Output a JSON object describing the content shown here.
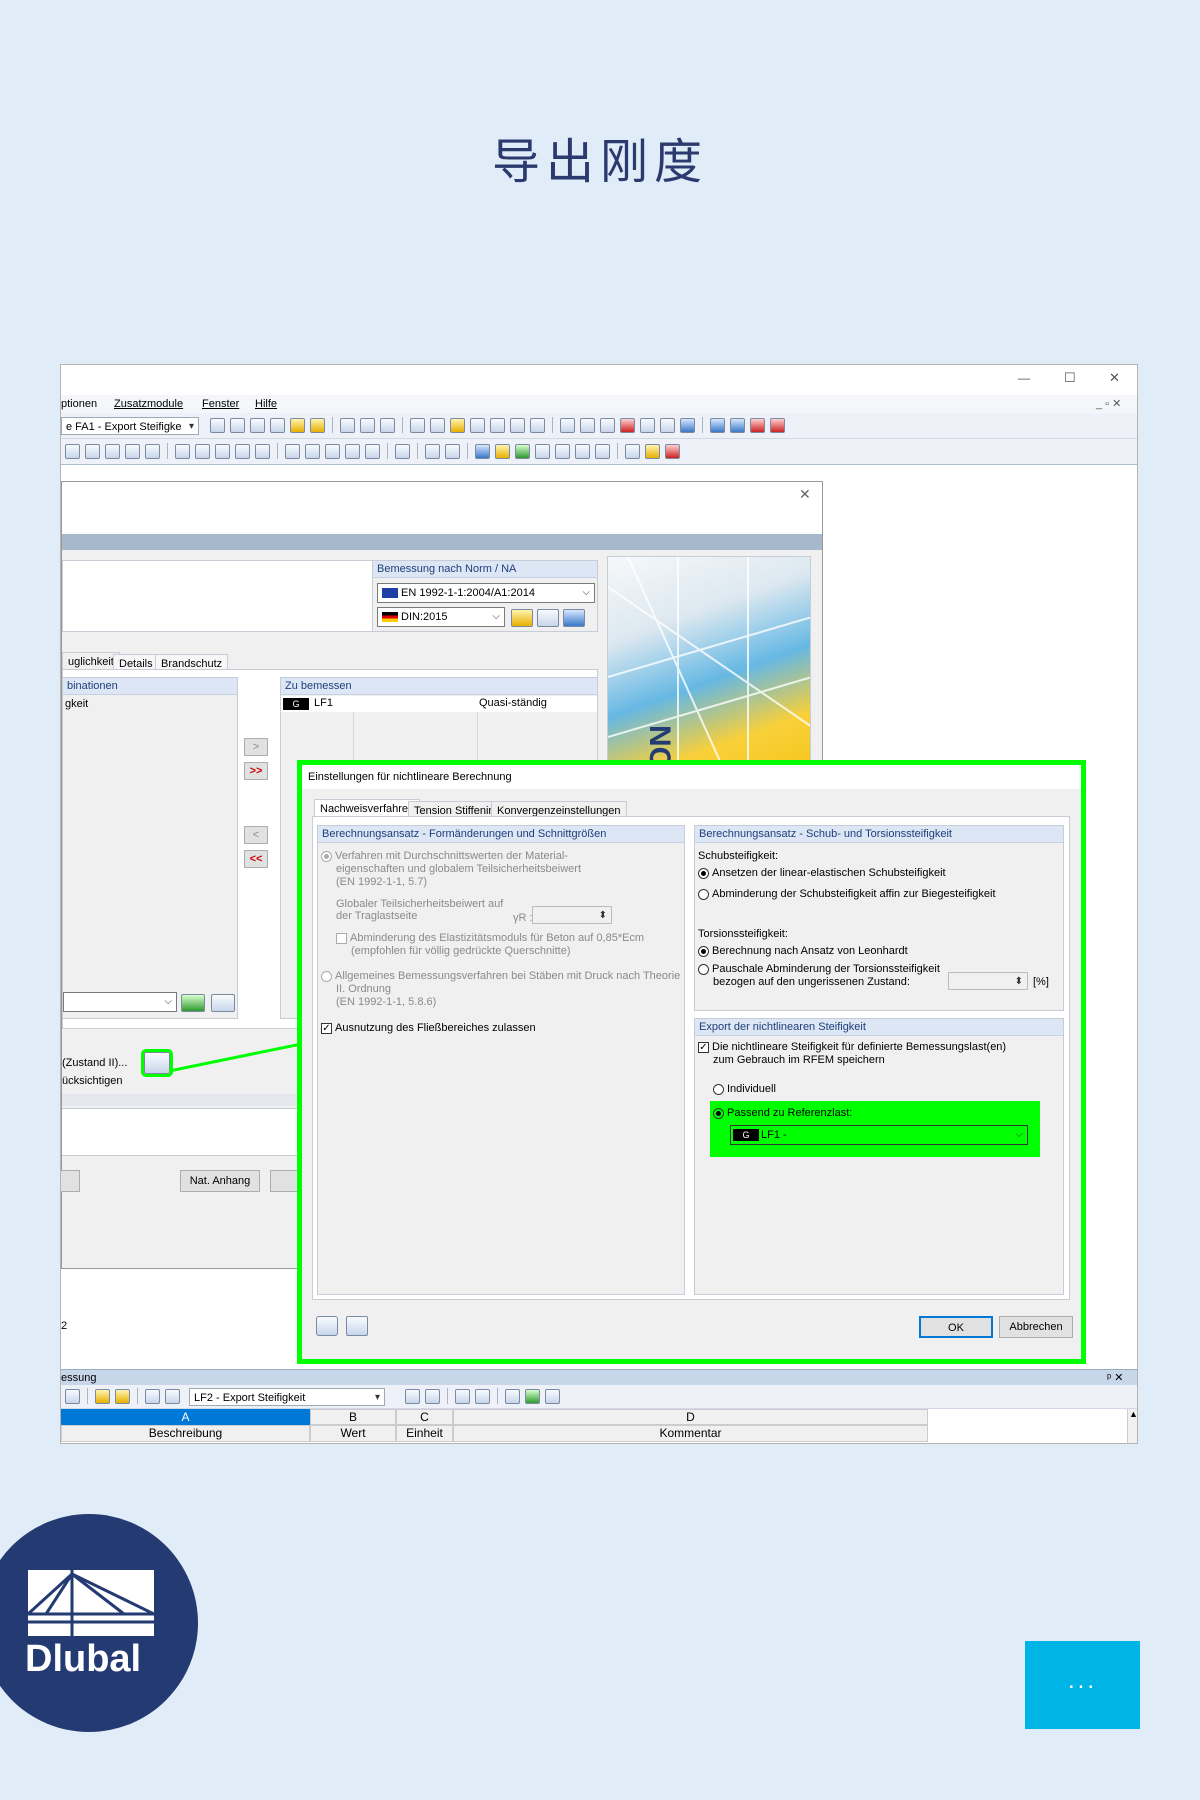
{
  "page": {
    "title": "导出刚度"
  },
  "window": {
    "controls": [
      "—",
      "☐",
      "✕"
    ],
    "mdi_controls": "_ ▫ ✕"
  },
  "menu": [
    "ptionen",
    "Zusatzmodule",
    "Fenster",
    "Hilfe"
  ],
  "toolbar": {
    "case_combo": "e FA1 - Export Steifigke"
  },
  "bg_dialog": {
    "norm_group": "Bemessung nach Norm / NA",
    "norm_value": "EN 1992-1-1:2004/A1:2014",
    "na_value": "DIN:2015",
    "tabs": [
      "uglichkeit",
      "Details",
      "Brandschutz"
    ],
    "left_list_header": "binationen",
    "left_list_item": "gkeit",
    "right_list_header": "Zu bemessen",
    "right_row": {
      "badge": "G",
      "name": "LF1",
      "type": "Quasi-ständig"
    },
    "zustand_text": "(Zustand II)...",
    "cksicht_text": "ücksichtigen",
    "nat_anhang": "Nat. Anhang",
    "footer_num": "2",
    "move_right": ">",
    "move_all_right": ">>",
    "move_left": "<",
    "move_all_left": "<<"
  },
  "nl_dialog": {
    "title": "Einstellungen für nichtlineare Berechnung",
    "tabs": [
      "Nachweisverfahren",
      "Tension Stiffening",
      "Konvergenzeinstellungen"
    ],
    "left_group": "Berechnungsansatz - Formänderungen und Schnittgrößen",
    "opt1": [
      "Verfahren mit Durchschnittswerten der Material-",
      "eigenschaften und globalem Teilsicherheitsbeiwert",
      "(EN 1992-1-1, 5.7)"
    ],
    "global_label": [
      "Globaler Teilsicherheitsbeiwert auf",
      "der Traglastseite"
    ],
    "gamma_label": "γR :",
    "abminderung": [
      "Abminderung des Elastizitätsmoduls für Beton auf 0,85*Ecm",
      "(empfohlen für völlig gedrückte Querschnitte)"
    ],
    "opt2": [
      "Allgemeines Bemessungsverfahren bei Stäben mit Druck nach Theorie",
      "II. Ordnung",
      "(EN 1992-1-1, 5.8.6)"
    ],
    "fliess": "Ausnutzung des Fließbereiches zulassen",
    "right_group": "Berechnungsansatz - Schub- und Torsionssteifigkeit",
    "schub_label": "Schubsteifigkeit:",
    "schub_opt1": "Ansetzen der linear-elastischen Schubsteifigkeit",
    "schub_opt2": "Abminderung der Schubsteifigkeit affin zur Biegesteifigkeit",
    "torsion_label": "Torsionssteifigkeit:",
    "torsion_opt1": "Berechnung nach Ansatz von Leonhardt",
    "torsion_opt2": [
      "Pauschale Abminderung der Torsionssteifigkeit",
      "bezogen auf den ungerissenen Zustand:"
    ],
    "percent": "[%]",
    "export_group": "Export der nichtlinearen Steifigkeit",
    "export_chk": [
      "Die nichtlineare Steifigkeit für definierte Bemessungslast(en)",
      "zum Gebrauch im RFEM speichern"
    ],
    "individuell": "Individuell",
    "passend": "Passend zu Referenzlast:",
    "ref_badge": "G",
    "ref_value": "LF1 -",
    "ok": "OK",
    "cancel": "Abbrechen"
  },
  "bottom": {
    "panel_title": "essung",
    "combo": "LF2 - Export Steifigkeit",
    "col_letters": [
      "A",
      "B",
      "C",
      "D"
    ],
    "col_headers": [
      "Beschreibung",
      "Wert",
      "Einheit",
      "Kommentar"
    ],
    "pin": "ᵖ ✕"
  },
  "logo": {
    "text": "Dlubal"
  },
  "more": {
    "label": "..."
  },
  "colors": {
    "background": "#e0ecf8",
    "title": "#2b3a6e",
    "highlight": "#00ff00",
    "logo_bg": "#243a72",
    "more_bg": "#00b4e6"
  }
}
